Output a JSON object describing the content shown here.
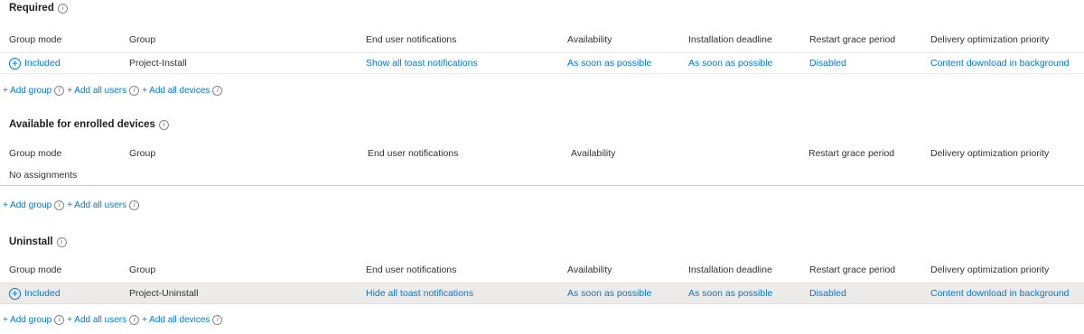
{
  "columns": {
    "group_mode": "Group mode",
    "group": "Group",
    "end_user_notifications": "End user notifications",
    "availability": "Availability",
    "installation_deadline": "Installation deadline",
    "restart_grace_period": "Restart grace period",
    "delivery_optimization_priority": "Delivery optimization priority"
  },
  "required": {
    "title": "Required",
    "row": {
      "group_mode": "Included",
      "group": "Project-Install",
      "end_user_notifications": "Show all toast notifications",
      "availability": "As soon as possible",
      "installation_deadline": "As soon as possible",
      "restart_grace_period": "Disabled",
      "delivery_optimization_priority": "Content download in background"
    },
    "actions": {
      "add_group": "+ Add group",
      "add_all_users": "+ Add all users",
      "add_all_devices": "+ Add all devices"
    }
  },
  "available": {
    "title": "Available for enrolled devices",
    "empty_text": "No assignments",
    "actions": {
      "add_group": "+ Add group",
      "add_all_users": "+ Add all users"
    }
  },
  "uninstall": {
    "title": "Uninstall",
    "row": {
      "group_mode": "Included",
      "group": "Project-Uninstall",
      "end_user_notifications": "Hide all toast notifications",
      "availability": "As soon as possible",
      "installation_deadline": "As soon as possible",
      "restart_grace_period": "Disabled",
      "delivery_optimization_priority": "Content download in background"
    },
    "actions": {
      "add_group": "+ Add group",
      "add_all_users": "+ Add all users",
      "add_all_devices": "+ Add all devices"
    }
  },
  "icons": {
    "info": "info-icon",
    "included": "plus-circle-icon"
  },
  "colors": {
    "link": "#0078d4",
    "text": "#323130",
    "row_highlight": "#edebe9"
  }
}
